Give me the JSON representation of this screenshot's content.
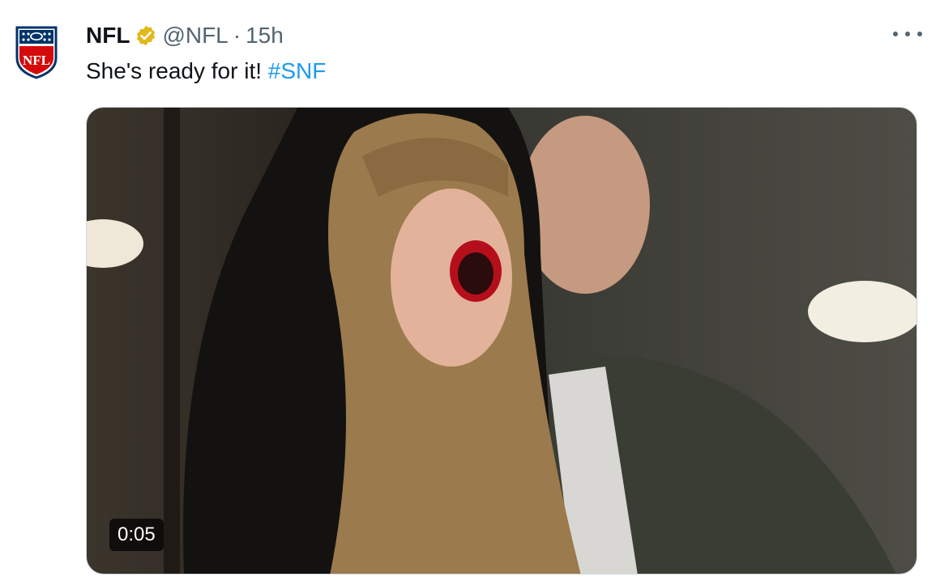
{
  "account": {
    "name": "NFL",
    "handle": "@NFL",
    "separator": "·",
    "time": "15h",
    "verified": true,
    "avatar_icon": "nfl-shield-logo",
    "avatar_text": "NFL"
  },
  "tweet": {
    "text": "She's ready for it! ",
    "hashtag": "#SNF"
  },
  "media": {
    "type": "video",
    "duration": "0:05",
    "description": "video still of a cheering woman in a stadium suite"
  },
  "icons": {
    "more": "more-horizontal-icon",
    "verified": "verified-badge-icon"
  },
  "colors": {
    "link": "#1d9bf0",
    "secondary_text": "#536471",
    "verified_gold": "#e2b719",
    "nfl_navy": "#013369",
    "nfl_red": "#d50a0a"
  }
}
